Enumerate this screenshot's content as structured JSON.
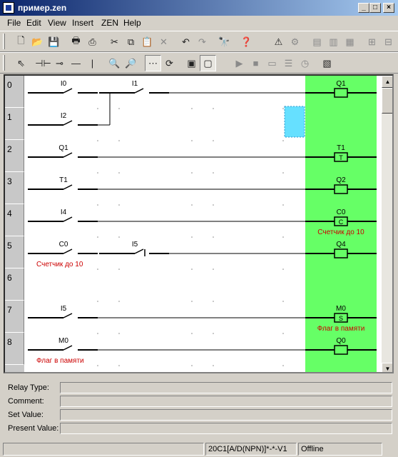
{
  "window": {
    "title": "пример.zen",
    "min_btn": "_",
    "max_btn": "□",
    "close_btn": "×"
  },
  "menu": [
    "File",
    "Edit",
    "View",
    "Insert",
    "ZEN",
    "Help"
  ],
  "toolbar1": [
    "new-icon",
    "open-icon",
    "save-icon",
    "print-icon",
    "print-preview-icon",
    "cut-icon",
    "copy-icon",
    "paste-icon",
    "delete-icon",
    "undo-icon",
    "redo-icon",
    "find-icon",
    "help-icon",
    "warning-icon",
    "transfer-icon",
    "read-plc-icon",
    "write-plc-icon",
    "compare-icon",
    "connect-icon",
    "disconnect-icon"
  ],
  "toolbar2": [
    "pointer-icon",
    "contact-no-icon",
    "contact-nc-icon",
    "horizontal-line-icon",
    "vertical-line-icon",
    "zoom-in-icon",
    "zoom-out-icon",
    "grid-icon",
    "redraw-icon",
    "ladder-view-icon",
    "function-view-icon",
    "run-icon",
    "stop-icon",
    "monitor-icon",
    "list-icon",
    "clock-icon",
    "settings-icon"
  ],
  "rows": [
    "0",
    "1",
    "2",
    "3",
    "4",
    "5",
    "6",
    "7",
    "8"
  ],
  "ladder": {
    "contacts": [
      {
        "row": 0,
        "label": "I0",
        "type": "no",
        "col": 0
      },
      {
        "row": 0,
        "label": "I1",
        "type": "no",
        "col": 1
      },
      {
        "row": 1,
        "label": "I2",
        "type": "no",
        "col": 0
      },
      {
        "row": 2,
        "label": "Q1",
        "type": "no",
        "col": 0
      },
      {
        "row": 3,
        "label": "T1",
        "type": "no",
        "col": 0
      },
      {
        "row": 4,
        "label": "I4",
        "type": "no",
        "col": 0
      },
      {
        "row": 5,
        "label": "C0",
        "type": "no",
        "col": 0
      },
      {
        "row": 5,
        "label": "I5",
        "type": "nc",
        "col": 1
      },
      {
        "row": 7,
        "label": "I5",
        "type": "no",
        "col": 0
      },
      {
        "row": 8,
        "label": "M0",
        "type": "no",
        "col": 0
      }
    ],
    "coils": [
      {
        "row": 0,
        "label": "Q1",
        "symbol": ""
      },
      {
        "row": 2,
        "label": "T1",
        "symbol": "T"
      },
      {
        "row": 3,
        "label": "Q2",
        "symbol": ""
      },
      {
        "row": 4,
        "label": "C0",
        "symbol": "C"
      },
      {
        "row": 5,
        "label": "Q4",
        "symbol": ""
      },
      {
        "row": 7,
        "label": "M0",
        "symbol": "S"
      },
      {
        "row": 8,
        "label": "Q0",
        "symbol": ""
      }
    ],
    "comments": [
      {
        "row": 4,
        "where": "coil",
        "text": "Счетчик до 10"
      },
      {
        "row": 5,
        "where": "left",
        "text": "Счетчик до 10"
      },
      {
        "row": 7,
        "where": "coil",
        "text": "Флаг в памяти"
      },
      {
        "row": 8,
        "where": "left",
        "text": "Флаг в памяти"
      }
    ],
    "colors": {
      "coil_zone": "#66ff66",
      "cursor": "#66e0ff",
      "comment": "#cc0000"
    }
  },
  "props": {
    "labels": [
      "Relay Type:",
      "Comment:",
      "Set Value:",
      "Present Value:"
    ]
  },
  "status": {
    "model": "20C1[A/D(NPN)]*-*-V1",
    "state": "Offline"
  }
}
